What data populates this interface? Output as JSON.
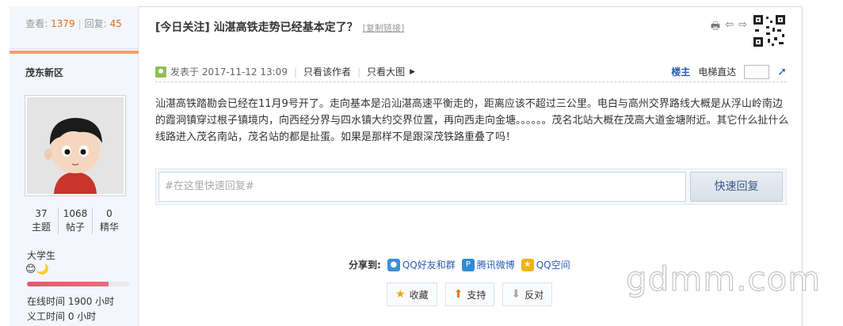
{
  "sidebar": {
    "views_label": "查看:",
    "views": "1379",
    "replies_label": "回复:",
    "replies": "45",
    "username": "茂东新区",
    "stats": [
      {
        "value": "37",
        "label": "主题"
      },
      {
        "value": "1068",
        "label": "帖子"
      },
      {
        "value": "0",
        "label": "精华"
      }
    ],
    "rank": "大学生",
    "medals": "😊🌙",
    "level_progress": 0.8,
    "online_time": "在线时间   1900 小时",
    "volunteer_time": "义工时间   0 小时"
  },
  "post": {
    "title": "[今日关注] 汕湛高铁走势已经基本定了？",
    "copy_link": "[复制链接]",
    "posted_at": "发表于 2017-11-12 13:09",
    "only_author": "只看该作者",
    "big_image": "只看大图",
    "floor": "楼主",
    "elevator": "电梯直达",
    "content": "汕湛高铁踏勘会已经在11月9号开了。走向基本是沿汕湛高速平衡走的，距离应该不超过三公里。电白与高州交界路线大概是从浮山岭南边的霞洞镇穿过根子镇境内，向西经分界与四水镇大约交界位置，再向西走向金塘。。。。。。茂名北站大概在茂高大道金塘附近。其它什么扯什么线路进入茂名南站，茂名站的都是扯蛋。如果是那样不是跟深茂铁路重叠了吗！"
  },
  "quick_reply": {
    "placeholder": "#在这里快速回复#",
    "button": "快速回复"
  },
  "share": {
    "label": "分享到:",
    "qq_friends": "QQ好友和群",
    "weibo": "腾讯微博",
    "qzone": "QQ空间"
  },
  "actions": {
    "favorite": "收藏",
    "support": "支持",
    "oppose": "反对"
  },
  "watermark": "gdmm.com"
}
